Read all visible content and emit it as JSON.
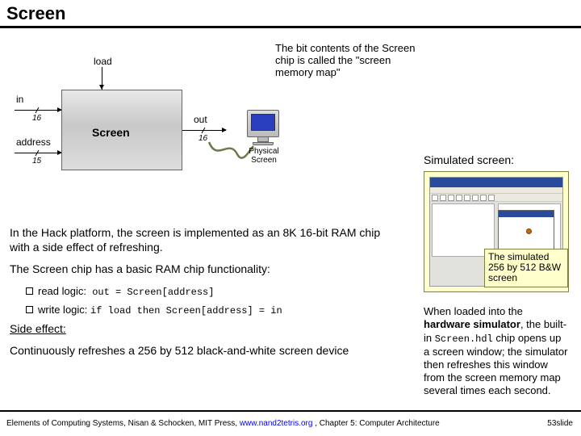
{
  "title": "Screen",
  "caption_top": "The bit contents of the Screen chip is called the \"screen memory map\"",
  "diagram": {
    "chip": "Screen",
    "in": "in",
    "load": "load",
    "address": "address",
    "out": "out",
    "bus_in": "16",
    "bus_addr": "15",
    "bus_out": "16",
    "physical": "Physical Screen"
  },
  "sim_label": "Simulated screen:",
  "sim_note": "The simulated 256 by 512 B&W screen",
  "left": {
    "p1": "In the Hack platform, the screen is implemented as an 8K 16-bit RAM chip with a side effect of refreshing.",
    "p2": "The Screen chip has a basic RAM chip functionality:",
    "b1_label": "read logic:",
    "b1_code": "out = Screen[address]",
    "b2_label": "write logic:",
    "b2_code": "if load then Screen[address] = in",
    "side_hdr": "Side effect:",
    "p3": "Continuously refreshes a 256 by 512 black-and-white screen device"
  },
  "side": {
    "t1": "When loaded into the ",
    "kw1": "hardware simulator",
    "t2": ", the built-in ",
    "code": "Screen.hdl",
    "t3": " chip opens up a screen window; the simulator then refreshes this window from the screen memory map several times each second."
  },
  "footer": {
    "prefix": "Elements of Computing Systems, Nisan & Schocken, MIT Press, ",
    "link": "www.nand2tetris.org",
    "suffix": " , Chapter 5: Computer Architecture",
    "slide": "53slide"
  }
}
